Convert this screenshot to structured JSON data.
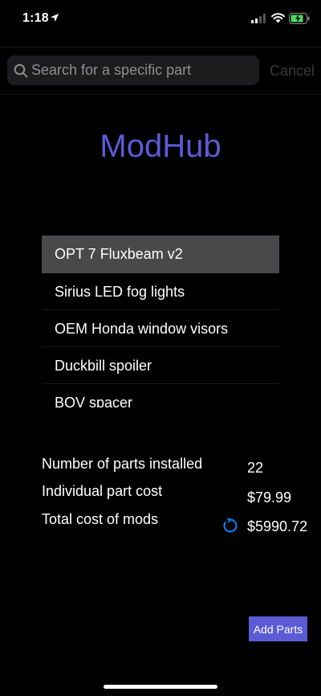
{
  "status_bar": {
    "time": "1:18",
    "icons": [
      "location-arrow-icon",
      "cellular-signal-icon",
      "wifi-icon",
      "battery-charging-icon"
    ]
  },
  "search": {
    "placeholder": "Search for a specific part",
    "value": "",
    "cancel_label": "Cancel"
  },
  "app_title": "ModHub",
  "parts": [
    {
      "label": "OPT 7 Fluxbeam v2",
      "selected": true
    },
    {
      "label": "Sirius LED fog lights",
      "selected": false
    },
    {
      "label": "OEM Honda window visors",
      "selected": false
    },
    {
      "label": "Duckbill spoiler",
      "selected": false
    },
    {
      "label": "BOV spacer",
      "selected": false
    }
  ],
  "stats": {
    "parts_installed_label": "Number of parts installed",
    "parts_installed_value": "22",
    "part_cost_label": "Individual part cost",
    "part_cost_value": "$79.99",
    "total_cost_label": "Total cost of mods",
    "total_cost_value": "$5990.72"
  },
  "add_parts_label": "Add Parts",
  "colors": {
    "accent": "#5b5bd6",
    "background": "#000000",
    "selected_row": "#49494b",
    "spinner": "#0a84ff"
  }
}
